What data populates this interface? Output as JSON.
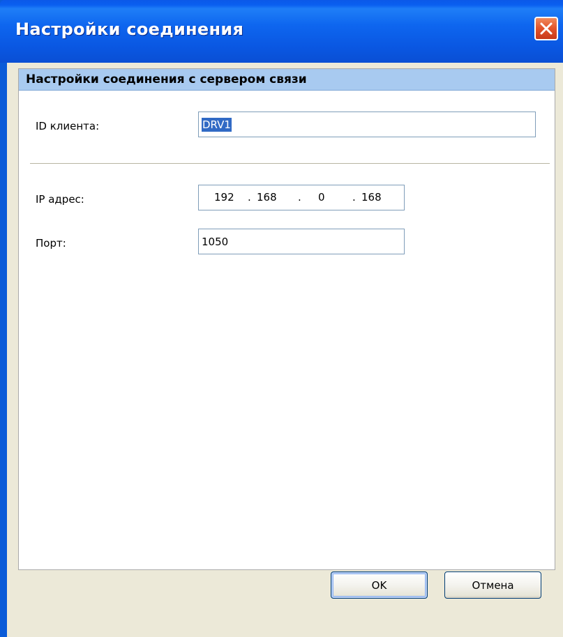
{
  "window": {
    "title": "Настройки соединения",
    "close_label": "×"
  },
  "panel": {
    "header": "Настройки соединения с сервером связи"
  },
  "form": {
    "client_id_label": "ID клиента:",
    "client_id_value": "DRV1",
    "ip_label": "IP адрес:",
    "ip_octets": [
      "192",
      "168",
      "0",
      "168"
    ],
    "ip_dot": ".",
    "port_label": "Порт:",
    "port_value": "1050"
  },
  "buttons": {
    "ok": "OK",
    "cancel": "Отмена"
  },
  "colors": {
    "titlebar": "#0a5bd8",
    "close": "#e2532a",
    "dialog_bg": "#ece9d8",
    "panel_header": "#a8caf0",
    "selection": "#316ac5"
  }
}
